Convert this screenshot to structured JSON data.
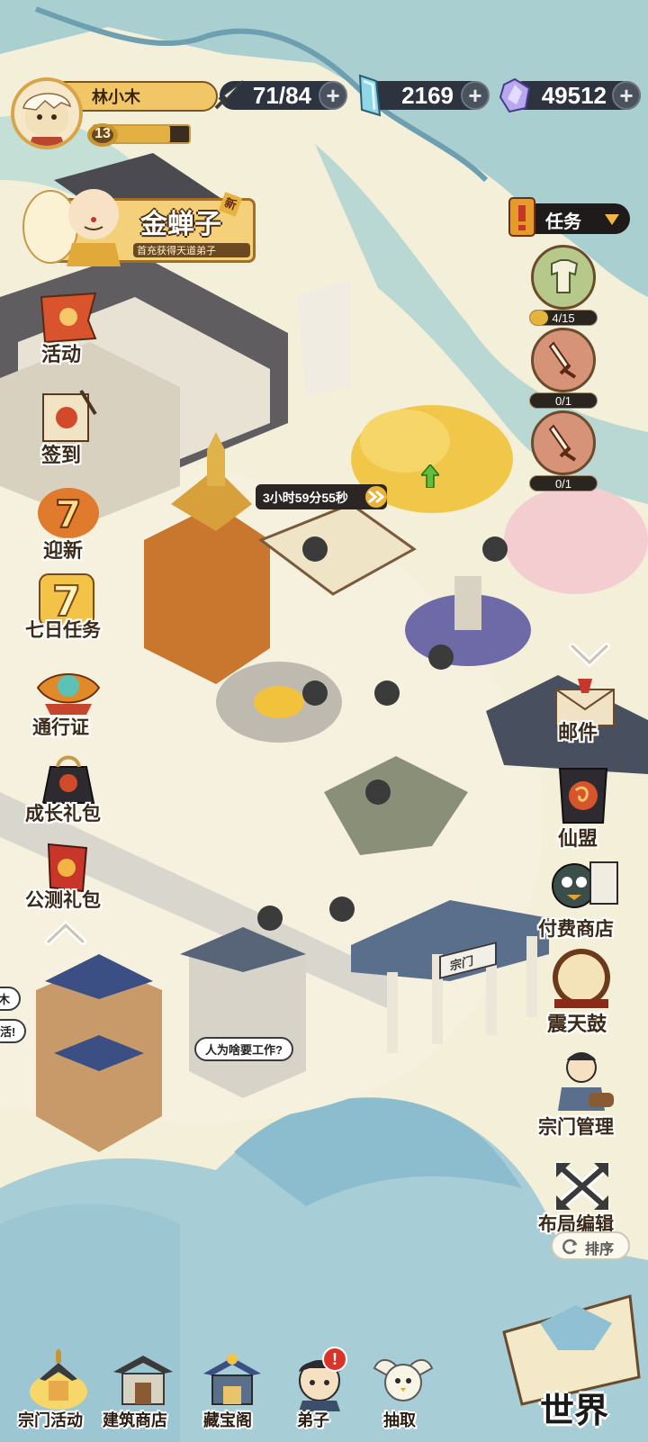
{
  "player": {
    "name": "林小木",
    "level": "13"
  },
  "resources": [
    {
      "icon": "sword-icon",
      "value": "71/84"
    },
    {
      "icon": "crystal-icon",
      "value": "2169"
    },
    {
      "icon": "gem-icon",
      "value": "49512"
    }
  ],
  "promo": {
    "title": "金蝉子",
    "subtitle": "首充获得天道弟子",
    "badge": "新"
  },
  "left_menu": [
    {
      "icon": "flag-icon",
      "label": "活动"
    },
    {
      "icon": "scroll-icon",
      "label": "签到"
    },
    {
      "icon": "seven-icon",
      "label": "迎新"
    },
    {
      "icon": "seven-gold-icon",
      "label": "七日任务"
    },
    {
      "icon": "lantern-icon",
      "label": "通行证"
    },
    {
      "icon": "gift-bag-icon",
      "label": "成长礼包"
    },
    {
      "icon": "banner-icon",
      "label": "公测礼包"
    }
  ],
  "tasks": {
    "title": "任务",
    "items": [
      {
        "icon": "clothes-icon",
        "progress": "4/15",
        "fraction": 0.27
      },
      {
        "icon": "sword-task-icon",
        "progress": "0/1",
        "fraction": 0
      },
      {
        "icon": "sword-task-icon",
        "progress": "0/1",
        "fraction": 0
      }
    ]
  },
  "right_menu": [
    {
      "icon": "mail-icon",
      "label": "邮件"
    },
    {
      "icon": "alliance-icon",
      "label": "仙盟"
    },
    {
      "icon": "shop-icon",
      "label": "付费商店"
    },
    {
      "icon": "drum-icon",
      "label": "震天鼓"
    },
    {
      "icon": "sect-manage-icon",
      "label": "宗门管理"
    },
    {
      "icon": "layout-edit-icon",
      "label": "布局编辑"
    }
  ],
  "sort_button": "排序",
  "timer": "3小时59分55秒",
  "gate_sign": "宗门",
  "speech_bubbles": [
    "人为啥要工作?",
    "活!",
    "木"
  ],
  "bottom_nav": [
    {
      "icon": "sect-activity-icon",
      "label": "宗门活动"
    },
    {
      "icon": "building-shop-icon",
      "label": "建筑商店"
    },
    {
      "icon": "treasure-pavilion-icon",
      "label": "藏宝阁"
    },
    {
      "icon": "disciple-icon",
      "label": "弟子",
      "alert": "!"
    },
    {
      "icon": "draw-icon",
      "label": "抽取"
    }
  ],
  "world_button": "世界"
}
